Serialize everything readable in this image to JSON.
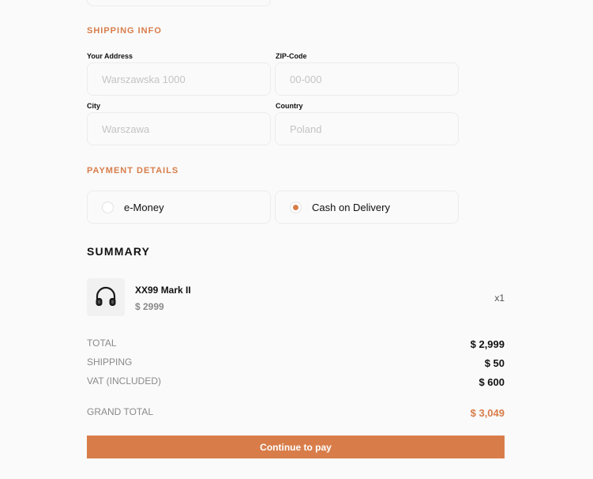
{
  "shipping": {
    "section_title": "SHIPPING INFO",
    "address_label": "Your Address",
    "address_placeholder": "Warszawska 1000",
    "zip_label": "ZIP-Code",
    "zip_placeholder": "00-000",
    "city_label": "City",
    "city_placeholder": "Warszawa",
    "country_label": "Country",
    "country_placeholder": "Poland"
  },
  "payment": {
    "section_title": "PAYMENT DETAILS",
    "options": [
      {
        "label": "e-Money",
        "selected": false
      },
      {
        "label": "Cash on Delivery",
        "selected": true
      }
    ]
  },
  "summary": {
    "title": "SUMMARY",
    "product": {
      "name": "XX99 Mark II",
      "price": "$ 2999",
      "quantity": "x1",
      "icon": "headphones-icon"
    },
    "total_label": "TOTAL",
    "total_value": "$ 2,999",
    "shipping_label": "SHIPPING",
    "shipping_value": "$ 50",
    "vat_label": "VAT (INCLUDED)",
    "vat_value": "$ 600",
    "grand_total_label": "GRAND TOTAL",
    "grand_total_value": "$ 3,049"
  },
  "actions": {
    "continue_label": "Continue to pay"
  },
  "colors": {
    "accent": "#d87d4a",
    "background": "#fafafa",
    "border": "#ececec"
  }
}
